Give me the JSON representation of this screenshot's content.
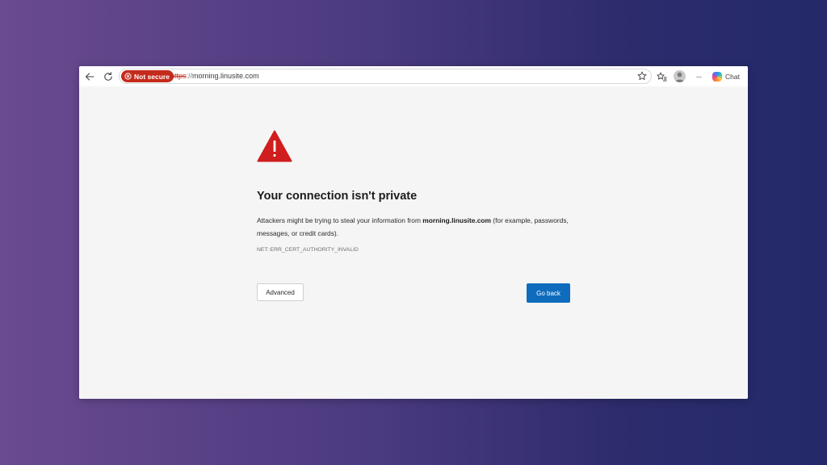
{
  "toolbar": {
    "back_icon": "back-arrow-icon",
    "refresh_icon": "refresh-icon",
    "security_badge": "Not secure",
    "url_scheme": "https",
    "url_separator": "://",
    "url_host": "morning.linusite.com",
    "favorites_icon": "star-icon",
    "collections_icon": "favorites-list-icon",
    "more_label": "···",
    "chat_label": "Chat"
  },
  "error_page": {
    "title": "Your connection isn't private",
    "desc_before": "Attackers might be trying to steal your information from ",
    "desc_host": "morning.linusite.com",
    "desc_after": " (for example, passwords, messages, or credit cards).",
    "error_code": "NET::ERR_CERT_AUTHORITY_INVALID",
    "advanced_label": "Advanced",
    "go_back_label": "Go back"
  },
  "colors": {
    "warning_red": "#d01d1d",
    "not_secure_badge": "#c42b1c",
    "primary_button": "#0f6cbd",
    "page_background": "#f5f5f5"
  }
}
